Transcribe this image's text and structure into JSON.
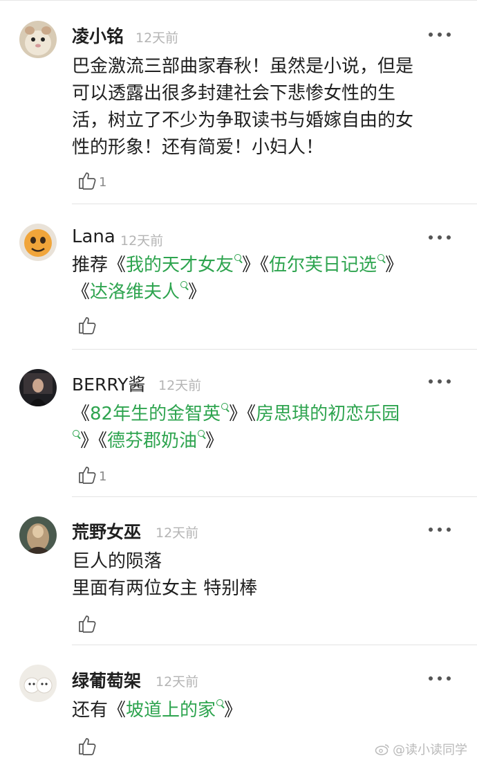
{
  "comments": [
    {
      "name": "凌小铭",
      "time": "12天前",
      "lines": [
        [
          {
            "t": "巴金激流三部曲家春秋！虽然是小说，但是"
          }
        ],
        [
          {
            "t": "可以透露出很多封建社会下悲惨女性的生"
          }
        ],
        [
          {
            "t": "活，树立了不少为争取读书与婚嫁自由的女"
          }
        ],
        [
          {
            "t": "性的形象！还有简爱！小妇人！"
          }
        ]
      ],
      "likes": "1",
      "avatar": "hamster-avatar"
    },
    {
      "name": "Lana",
      "time": "12天前",
      "lines": [
        [
          {
            "t": "推荐《"
          },
          {
            "t": "我的天才女友",
            "link": true
          },
          {
            "t": "》《"
          },
          {
            "t": "伍尔芙日记选",
            "link": true
          },
          {
            "t": "》"
          }
        ],
        [
          {
            "t": "《"
          },
          {
            "t": "达洛维夫人",
            "link": true
          },
          {
            "t": "》"
          }
        ]
      ],
      "likes": "",
      "avatar": "cartoon-avatar"
    },
    {
      "name": "BERRY酱",
      "time": "12天前",
      "lines": [
        [
          {
            "t": "《"
          },
          {
            "t": "82年生的金智英",
            "link": true
          },
          {
            "t": "》《"
          },
          {
            "t": "房思琪的初恋乐园",
            "link": true,
            "noicon": true
          }
        ],
        [
          {
            "t": "",
            "link": true,
            "iconOnly": true
          },
          {
            "t": "》《"
          },
          {
            "t": "德芬郡奶油",
            "link": true
          },
          {
            "t": "》"
          }
        ]
      ],
      "likes": "1",
      "avatar": "photo-avatar"
    },
    {
      "name": "荒野女巫",
      "time": "12天前",
      "lines": [
        [
          {
            "t": "巨人的陨落"
          }
        ],
        [
          {
            "t": "里面有两位女主 特别棒"
          }
        ]
      ],
      "likes": "",
      "avatar": "painting-avatar"
    },
    {
      "name": "绿葡萄架",
      "time": "12天前",
      "lines": [
        [
          {
            "t": "还有《"
          },
          {
            "t": "坡道上的家",
            "link": true
          },
          {
            "t": "》"
          }
        ]
      ],
      "likes": "",
      "avatar": "animals-avatar"
    }
  ],
  "watermark": "@读小读同学"
}
